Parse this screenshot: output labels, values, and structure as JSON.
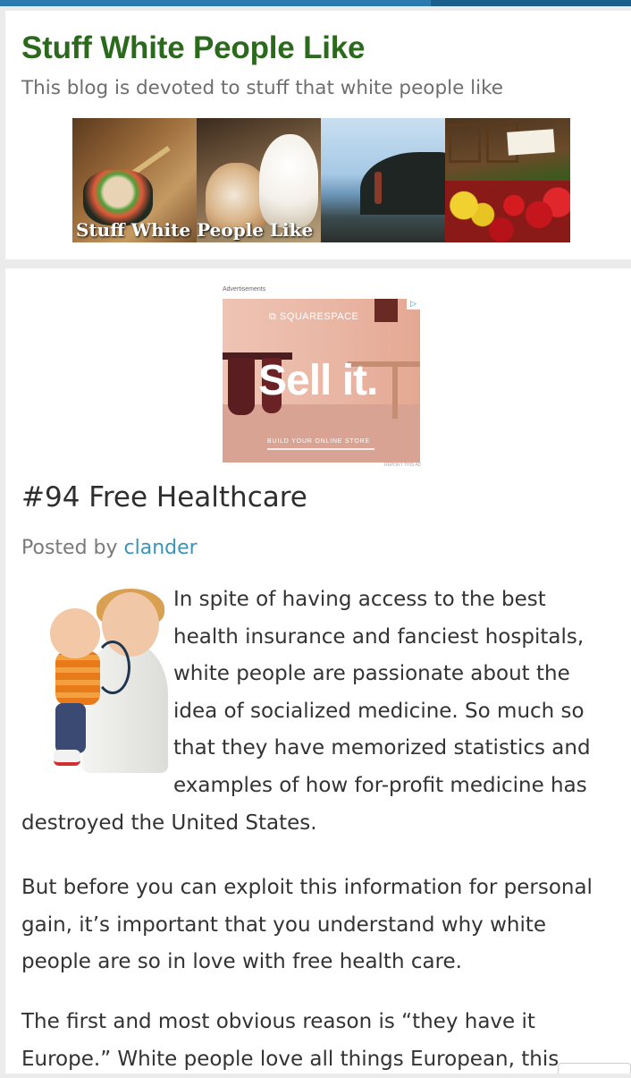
{
  "site": {
    "title": "Stuff White People Like",
    "description": "This blog is devoted to stuff that white people like",
    "banner_caption": "Stuff White People Like"
  },
  "ad": {
    "label": "Advertisements",
    "brand": "SQUARESPACE",
    "headline": "Sell it.",
    "cta": "BUILD YOUR ONLINE STORE",
    "choice_icon": "adchoices-icon",
    "report": "REPORT THIS AD"
  },
  "post": {
    "title": "#94 Free Healthcare",
    "byline_prefix": "Posted by",
    "author": "clander",
    "para1_lines": [
      "In spite of having access to the best",
      "health insurance and fanciest hospitals,",
      "white people are passionate about the",
      "idea of socialized medicine. So much so",
      "that they have memorized statistics and",
      "examples of how for-profit medicine has"
    ],
    "para1_tail": "destroyed the United States.",
    "para2_lines": [
      "But before you can exploit this information for personal",
      "gain, it’s important that you understand why white",
      "people are so in love with free health care."
    ],
    "para3_lines": [
      "The first and most obvious reason is “they have it",
      "Europe.” White people love all things European, this"
    ]
  },
  "colors": {
    "title_green": "#2b6a1c",
    "link_blue": "#3b93b8",
    "top_bar": "#2a7ab0"
  }
}
